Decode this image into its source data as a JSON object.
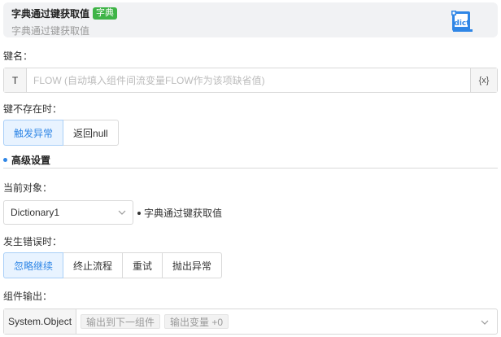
{
  "header": {
    "title": "字典通过键获取值",
    "tag": "字典",
    "subtitle": "字典通过键获取值",
    "icon": "dict-icon",
    "tag_color": "#3fb447"
  },
  "key_field": {
    "label": "键名：",
    "type_prefix": "T",
    "placeholder": "FLOW (自动填入组件间流变量FLOW作为该项缺省值)",
    "value": "",
    "variable_button": "{x}"
  },
  "key_missing": {
    "label": "键不存在时：",
    "options": [
      "触发异常",
      "返回null"
    ],
    "selected": "触发异常"
  },
  "advanced": {
    "title": "高级设置"
  },
  "current_object": {
    "label": "当前对象：",
    "value": "Dictionary1",
    "description": "字典通过键获取值"
  },
  "on_error": {
    "label": "发生错误时：",
    "options": [
      "忽略继续",
      "终止流程",
      "重试",
      "抛出异常"
    ],
    "selected": "忽略继续"
  },
  "output": {
    "label": "组件输出：",
    "type": "System.Object",
    "chips": [
      "输出到下一组件",
      "输出变量 +0"
    ]
  },
  "colors": {
    "accent": "#2f86e6",
    "active_bg": "#e8f3ff"
  }
}
